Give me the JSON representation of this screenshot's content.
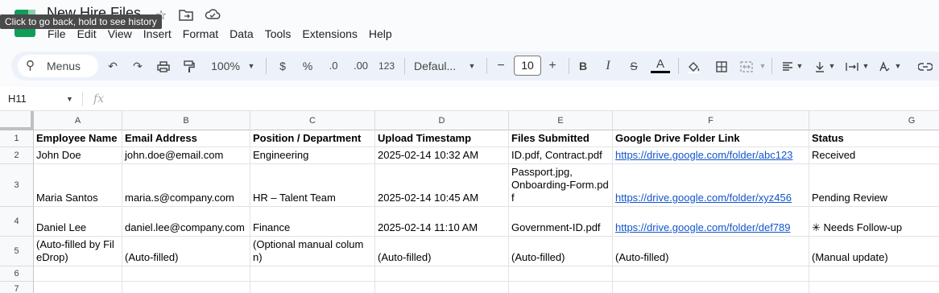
{
  "window": {
    "doc_title": "New Hire Files",
    "tooltip": "Click to go back, hold to see history",
    "star_icon": "star-icon",
    "move_icon": "move-to-folder-icon",
    "cloud_icon": "cloud-status-icon"
  },
  "menubar": {
    "items": [
      "File",
      "Edit",
      "View",
      "Insert",
      "Format",
      "Data",
      "Tools",
      "Extensions",
      "Help"
    ]
  },
  "toolbar": {
    "search_placeholder": "Menus",
    "zoom": "100%",
    "currency": "$",
    "percent": "%",
    "dec_decrease": ".0",
    "dec_increase": ".00",
    "number_format": "123",
    "font": "Defaul...",
    "font_size": "10",
    "minus": "−",
    "plus": "+",
    "bold": "B",
    "italic": "I",
    "strike": "S",
    "text_color": "A",
    "text_color_value": "#000000"
  },
  "formula_bar": {
    "name_box": "H11",
    "fx": "fx",
    "value": ""
  },
  "sheet": {
    "columns": [
      "A",
      "B",
      "C",
      "D",
      "E",
      "F",
      "G"
    ],
    "row_numbers": [
      "1",
      "2",
      "3",
      "4",
      "5",
      "6",
      "7"
    ],
    "rows": [
      [
        "Employee Name",
        "Email Address",
        "Position / Department",
        "Upload Timestamp",
        "Files Submitted",
        "Google Drive Folder Link",
        "Status"
      ],
      [
        "John Doe",
        "john.doe@email.com",
        "Engineering",
        "2025-02-14 10:32 AM",
        "ID.pdf, Contract.pdf",
        "https://drive.google.com/folder/abc123",
        "Received"
      ],
      [
        "Maria Santos",
        "maria.s@company.com",
        "HR – Talent Team",
        "2025-02-14 10:45 AM",
        "Passport.jpg,\nOnboarding-Form.pdf",
        "https://drive.google.com/folder/xyz456",
        "Pending Review"
      ],
      [
        "Daniel Lee",
        "daniel.lee@company.com",
        "Finance",
        "2025-02-14 11:10 AM",
        "Government-ID.pdf",
        "https://drive.google.com/folder/def789",
        "✳ Needs Follow-up"
      ],
      [
        "(Auto-filled by FileDrop)",
        "(Auto-filled)",
        "(Optional manual column)",
        "(Auto-filled)",
        "(Auto-filled)",
        "(Auto-filled)",
        "(Manual update)"
      ],
      [
        "",
        "",
        "",
        "",
        "",
        "",
        ""
      ],
      [
        "",
        "",
        "",
        "",
        "",
        "",
        ""
      ]
    ],
    "link_color": "#1155cc"
  }
}
